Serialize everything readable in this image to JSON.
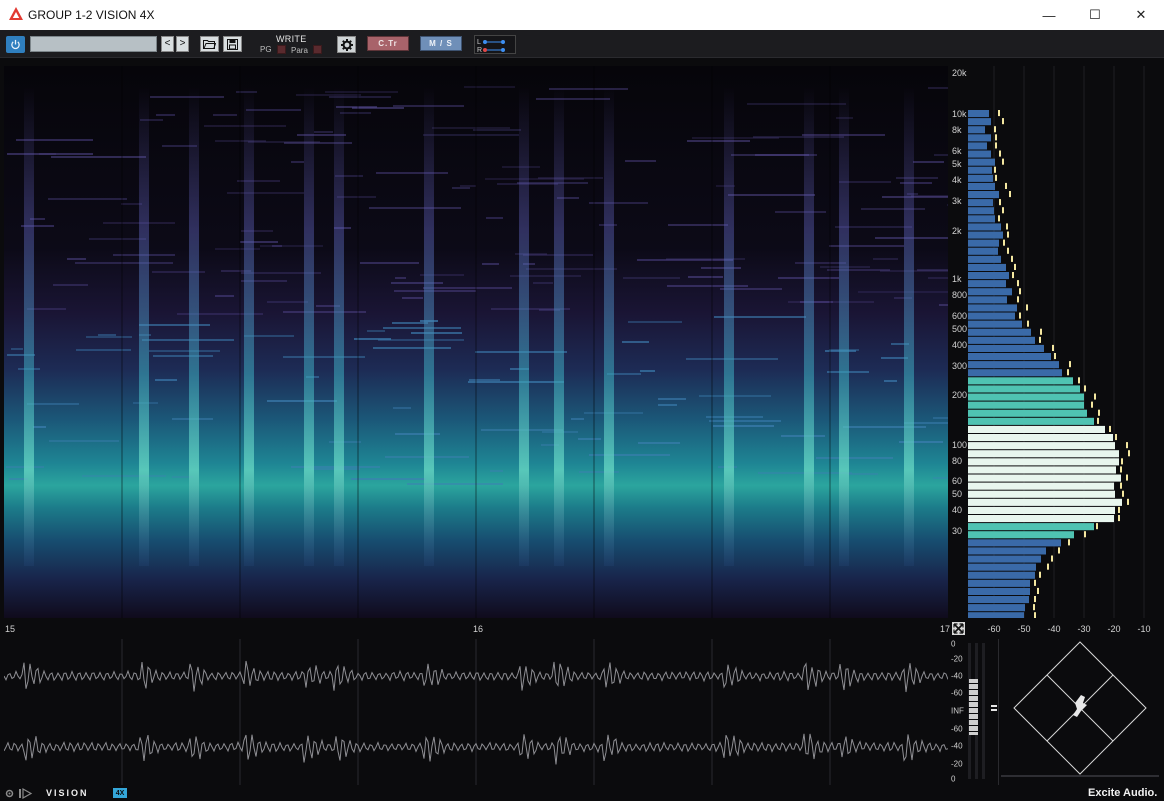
{
  "window": {
    "title": "GROUP 1-2 VISION 4X",
    "minimize_glyph": "—",
    "maximize_glyph": "☐",
    "close_glyph": "✕"
  },
  "toolbar": {
    "preset_value": "",
    "prev_glyph": "<",
    "next_glyph": ">",
    "write_label": "WRITE",
    "pg_label": "PG",
    "para_label": "Para",
    "ctr_label": "C.Tr",
    "ms_label": "M / S",
    "lr_l": "L",
    "lr_r": "R"
  },
  "colors": {
    "accent_blue": "#2f7fbf",
    "ctr_button": "#a8636a",
    "ms_button": "#6f8fb8",
    "spectrum_bar": "#3a6aa8",
    "spectrum_mid": "#4fc3b2",
    "spectrum_hot": "#e8f6ee",
    "peak_marker": "#f4e7a0",
    "brand_badge": "#34a6d8"
  },
  "spectrogram": {
    "freq_labels": [
      "20k",
      "10k",
      "8k",
      "6k",
      "5k",
      "4k",
      "3k",
      "2k",
      "1k",
      "800",
      "600",
      "500",
      "400",
      "300",
      "200",
      "100",
      "80",
      "60",
      "50",
      "40",
      "30"
    ]
  },
  "timeline": {
    "labels": [
      "15",
      "16",
      "17"
    ]
  },
  "spectrum_db_axis": {
    "labels": [
      "-60",
      "-50",
      "-40",
      "-30",
      "-20",
      "-10"
    ]
  },
  "level_meter": {
    "labels": [
      "0",
      "-20",
      "-40",
      "-60",
      "INF",
      "-60",
      "-40",
      "-20",
      "0"
    ]
  },
  "statusbar": {
    "brand_label": "VISION",
    "brand_badge": "4X",
    "company": "Excite Audio."
  }
}
